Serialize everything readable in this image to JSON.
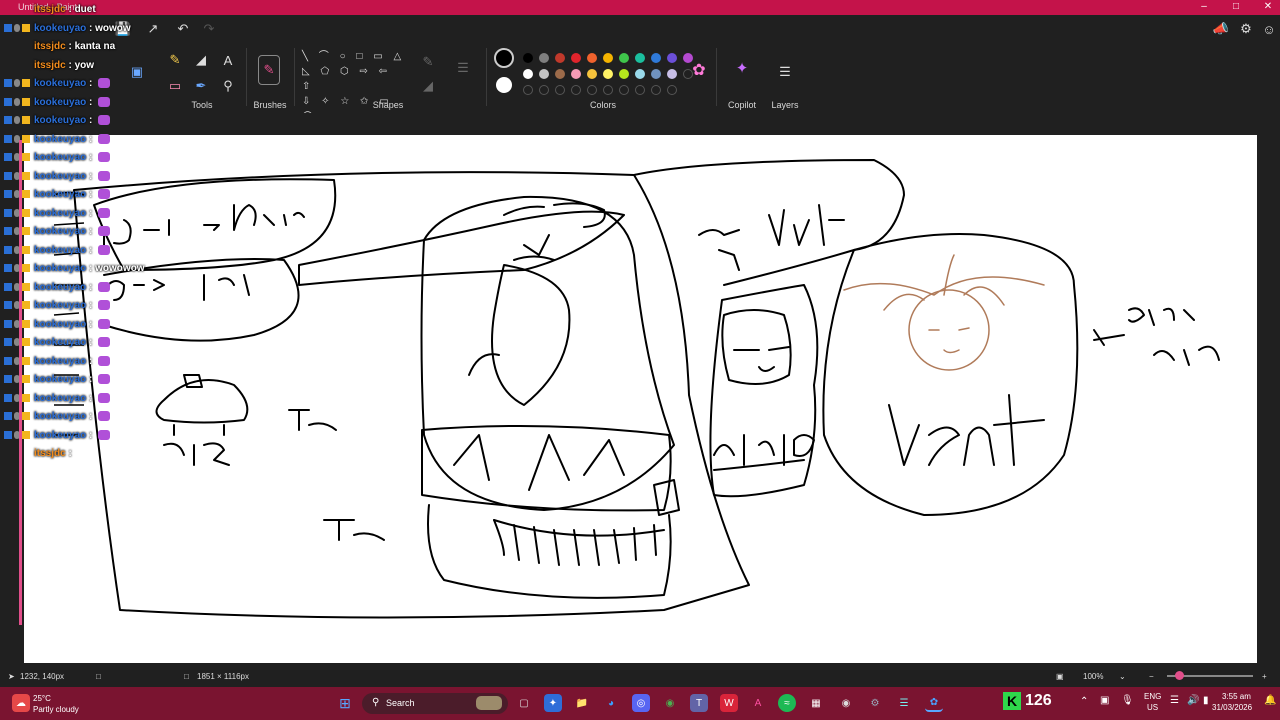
{
  "window": {
    "title": "Untitled - Paint"
  },
  "ribbon": {
    "groups": {
      "tools": "Tools",
      "brushes": "Brushes",
      "shapes": "Shapes",
      "colors": "Colors",
      "copilot": "Copilot",
      "layers": "Layers"
    }
  },
  "colors": {
    "row1": [
      "#000000",
      "#7f7f7f",
      "#c0392b",
      "#e0242c",
      "#f0622d",
      "#f5b400",
      "#3fc54b",
      "#1bbf9e",
      "#2f7ad9",
      "#6b4fd8",
      "#b44ad0"
    ],
    "row2": [
      "#ffffff",
      "#c3c3c3",
      "#9c6b4a",
      "#f59ab5",
      "#f6c33c",
      "#fff266",
      "#b5e61d",
      "#99d9ea",
      "#7092be",
      "#c8bfe7",
      ""
    ],
    "primary": "#000000",
    "secondary": "#ffffff"
  },
  "chat": [
    {
      "user": "itssjdc",
      "msg": "duet",
      "orange": true
    },
    {
      "user": "kookeuyao",
      "msg": "wowow",
      "orange": false
    },
    {
      "user": "itssjdc",
      "msg": "kanta na",
      "orange": true
    },
    {
      "user": "itssjdc",
      "msg": "yow",
      "orange": true
    },
    {
      "user": "kookeuyao",
      "msg": "",
      "orange": false
    },
    {
      "user": "kookeuyao",
      "msg": "",
      "orange": false
    },
    {
      "user": "kookeuyao",
      "msg": "",
      "orange": false
    },
    {
      "user": "kookeuyao",
      "msg": "",
      "orange": false
    },
    {
      "user": "kookeuyao",
      "msg": "",
      "orange": false
    },
    {
      "user": "kookeuyao",
      "msg": "",
      "orange": false
    },
    {
      "user": "kookeuyao",
      "msg": "",
      "orange": false
    },
    {
      "user": "kookeuyao",
      "msg": "",
      "orange": false
    },
    {
      "user": "kookeuyao",
      "msg": "",
      "orange": false
    },
    {
      "user": "kookeuyao",
      "msg": "",
      "orange": false
    },
    {
      "user": "kookeuyao",
      "msg": "wowowow",
      "orange": false
    },
    {
      "user": "kookeuyao",
      "msg": "",
      "orange": false
    },
    {
      "user": "kookeuyao",
      "msg": "",
      "orange": false
    },
    {
      "user": "kookeuyao",
      "msg": "",
      "orange": false
    },
    {
      "user": "kookeuyao",
      "msg": "",
      "orange": false
    },
    {
      "user": "kookeuyao",
      "msg": "",
      "orange": false
    },
    {
      "user": "kookeuyao",
      "msg": "",
      "orange": false
    },
    {
      "user": "kookeuyao",
      "msg": "",
      "orange": false
    },
    {
      "user": "kookeuyao",
      "msg": "",
      "orange": false
    },
    {
      "user": "kookeuyao",
      "msg": "",
      "orange": false
    },
    {
      "user": "itssjdc",
      "msg": "",
      "orange": true
    }
  ],
  "drawing": {
    "labels": [
      "Driver",
      "CaR",
      "beHo",
      "vent",
      "Sugar",
      "AYA",
      "googe/Audit"
    ]
  },
  "status": {
    "cursor_pos": "1232, 140px",
    "canvas_size": "1851 × 1116px",
    "zoom": "100%"
  },
  "taskbar": {
    "weather_temp": "25°C",
    "weather_desc": "Partly cloudy",
    "search_label": "Search",
    "kick_count": "126",
    "lang": "ENG",
    "region": "US",
    "time": "3:55 am",
    "date": "31/03/2026"
  }
}
